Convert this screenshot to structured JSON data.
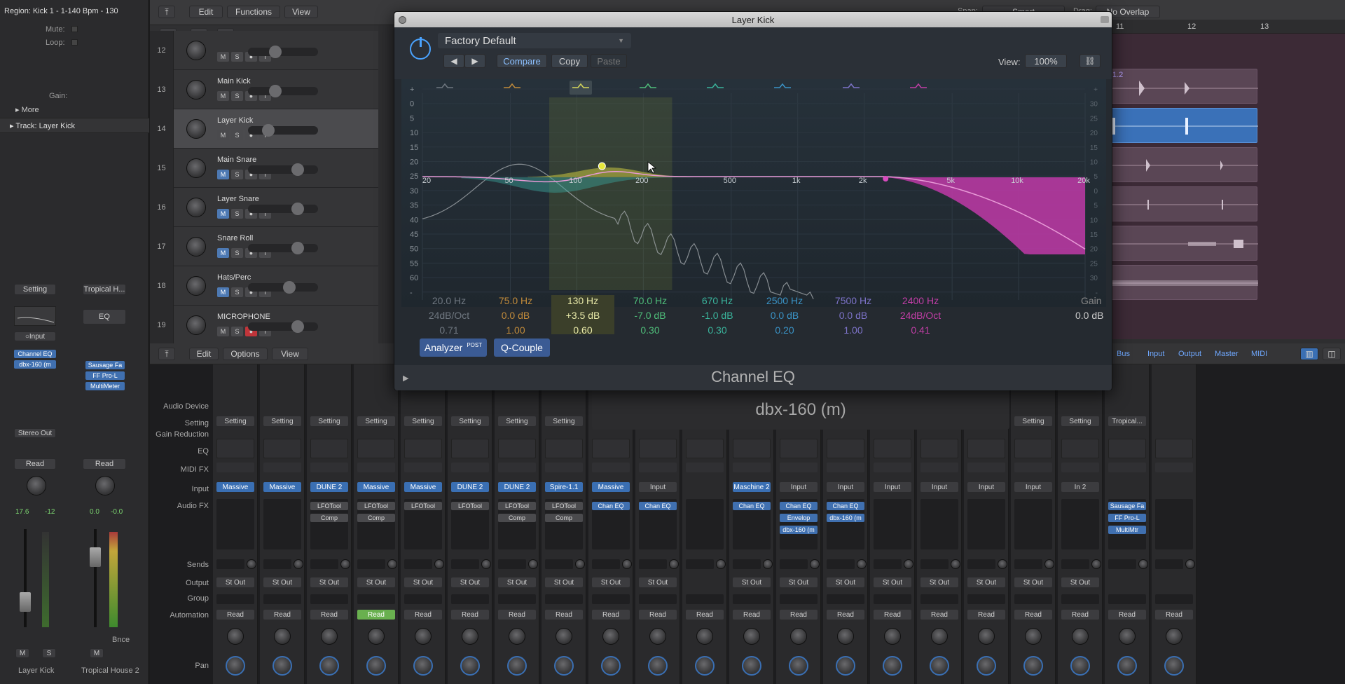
{
  "inspector": {
    "region_header": "Region: Kick 1 - 1-140 Bpm - 130",
    "mute_label": "Mute:",
    "loop_label": "Loop:",
    "gain_label": "Gain:",
    "more_label": "More",
    "track_label": "Track:  Layer Kick",
    "strip1": {
      "setting": "Setting",
      "input": "Input",
      "inserts": [
        "Channel EQ",
        "dbx-160 (m"
      ],
      "output": "Stereo Out",
      "automation": "Read",
      "vol": "17.6",
      "peak": "-12",
      "name": "Layer Kick",
      "m": "M",
      "s": "S"
    },
    "strip2": {
      "setting": "Tropical H...",
      "eq": "EQ",
      "inserts": [
        "Sausage Fa",
        "FF Pro-L",
        "MultiMeter"
      ],
      "automation": "Read",
      "vol": "0.0",
      "peak": "-0.0",
      "bnce": "Bnce",
      "name": "Tropical House 2",
      "m": "M"
    }
  },
  "arrange_toolbar": {
    "edit": "Edit",
    "functions": "Functions",
    "view": "View",
    "snap_label": "Snap:",
    "snap_value": "Smart",
    "drag_label": "Drag:",
    "drag_value": "No Overlap"
  },
  "track_header_btns": {
    "add": "+",
    "s": "S"
  },
  "tracks": [
    {
      "num": "12",
      "name": ""
    },
    {
      "num": "13",
      "name": "Main Kick"
    },
    {
      "num": "14",
      "name": "Layer Kick"
    },
    {
      "num": "15",
      "name": "Main Snare"
    },
    {
      "num": "16",
      "name": "Layer Snare"
    },
    {
      "num": "17",
      "name": "Snare Roll"
    },
    {
      "num": "18",
      "name": "Hats/Perc"
    },
    {
      "num": "19",
      "name": "MICROPHONE"
    }
  ],
  "ruler": [
    "11",
    "12",
    "13"
  ],
  "region_label": "1.2",
  "plugin": {
    "title": "Layer Kick",
    "preset": "Factory Default",
    "compare": "Compare",
    "copy": "Copy",
    "paste": "Paste",
    "view_label": "View:",
    "view_value": "100%",
    "db_scale": [
      "+",
      "0",
      "5",
      "10",
      "15",
      "20",
      "25",
      "30",
      "35",
      "40",
      "45",
      "50",
      "55",
      "60",
      "-"
    ],
    "right_scale": [
      "+",
      "30",
      "25",
      "20",
      "15",
      "10",
      "5",
      "0",
      "5",
      "10",
      "15",
      "20",
      "25",
      "30",
      "-"
    ],
    "freq_labels": [
      "20",
      "50",
      "100",
      "200",
      "500",
      "1k",
      "2k",
      "5k",
      "10k",
      "20k"
    ],
    "bands": [
      {
        "freq": "20.0 Hz",
        "gain": "24dB/Oct",
        "q": "0.71",
        "color": "#6f7780"
      },
      {
        "freq": "75.0 Hz",
        "gain": "0.0 dB",
        "q": "1.00",
        "color": "#c08a3a"
      },
      {
        "freq": "130 Hz",
        "gain": "+3.5 dB",
        "q": "0.60",
        "color": "#d5d65a"
      },
      {
        "freq": "70.0 Hz",
        "gain": "-7.0 dB",
        "q": "0.30",
        "color": "#4fbe7a"
      },
      {
        "freq": "670 Hz",
        "gain": "-1.0 dB",
        "q": "0.30",
        "color": "#3ab39b"
      },
      {
        "freq": "2500 Hz",
        "gain": "0.0 dB",
        "q": "0.20",
        "color": "#3a93c6"
      },
      {
        "freq": "7500 Hz",
        "gain": "0.0 dB",
        "q": "1.00",
        "color": "#7d73c9"
      },
      {
        "freq": "2400 Hz",
        "gain": "24dB/Oct",
        "q": "0.41",
        "color": "#c13ea6"
      }
    ],
    "gain_label": "Gain",
    "gain_value": "0.0 dB",
    "analyzer": "Analyzer",
    "analyzer_tag": "POST",
    "qcouple": "Q-Couple",
    "footer": "Channel EQ"
  },
  "dbx": {
    "name": "dbx-160 (m)"
  },
  "mixer_toolbar": {
    "edit": "Edit",
    "options": "Options",
    "view": "View",
    "tabs": [
      "Bus",
      "Input",
      "Output",
      "Master",
      "MIDI"
    ]
  },
  "mixer_labels": [
    "Audio Device",
    "Setting",
    "Gain Reduction",
    "EQ",
    "MIDI FX",
    "Input",
    "Audio FX",
    "Sends",
    "Output",
    "Group",
    "Automation",
    "Pan"
  ],
  "strips": [
    {
      "setting": "Setting",
      "input": "Massive",
      "fx": [],
      "output": "St Out",
      "auto": "Read"
    },
    {
      "setting": "Setting",
      "input": "Massive",
      "fx": [],
      "output": "St Out",
      "auto": "Read"
    },
    {
      "setting": "Setting",
      "input": "DUNE 2",
      "fx": [
        "LFOTool",
        "Comp"
      ],
      "output": "St Out",
      "auto": "Read"
    },
    {
      "setting": "Setting",
      "input": "Massive",
      "fx": [
        "LFOTool",
        "Comp"
      ],
      "output": "St Out",
      "auto": "Read"
    },
    {
      "setting": "Setting",
      "input": "Massive",
      "fx": [
        "LFOTool"
      ],
      "output": "St Out",
      "auto": "Read"
    },
    {
      "setting": "Setting",
      "input": "DUNE 2",
      "fx": [
        "LFOTool"
      ],
      "output": "St Out",
      "auto": "Read"
    },
    {
      "setting": "Setting",
      "input": "DUNE 2",
      "fx": [
        "LFOTool",
        "Comp"
      ],
      "output": "St Out",
      "auto": "Read"
    },
    {
      "setting": "Setting",
      "input": "Spire-1.1",
      "fx": [
        "LFOTool",
        "Comp"
      ],
      "output": "St Out",
      "auto": "Read"
    },
    {
      "setting": "",
      "input": "Massive",
      "fx": [
        "Chan EQ"
      ],
      "output": "St Out",
      "auto": "Read"
    },
    {
      "setting": "",
      "input": "Input",
      "fx": [
        "Chan EQ"
      ],
      "output": "St Out",
      "auto": "Read"
    },
    {
      "setting": "",
      "input": "",
      "fx": [],
      "output": "",
      "auto": "Read"
    },
    {
      "setting": "",
      "input": "Maschine 2",
      "fx": [
        "Chan EQ"
      ],
      "output": "St Out",
      "auto": "Read"
    },
    {
      "setting": "",
      "input": "Input",
      "fx": [
        "Chan EQ",
        "Envelop",
        "dbx-160 (m"
      ],
      "output": "St Out",
      "auto": "Read"
    },
    {
      "setting": "",
      "input": "Input",
      "fx": [
        "Chan EQ",
        "dbx-160 (m"
      ],
      "output": "St Out",
      "auto": "Read"
    },
    {
      "setting": "",
      "input": "Input",
      "fx": [],
      "output": "St Out",
      "auto": "Read"
    },
    {
      "setting": "",
      "input": "Input",
      "fx": [],
      "output": "St Out",
      "auto": "Read"
    },
    {
      "setting": "",
      "input": "Input",
      "fx": [],
      "output": "St Out",
      "auto": "Read"
    },
    {
      "setting": "Setting",
      "input": "Input",
      "fx": [],
      "output": "St Out",
      "auto": "Read"
    },
    {
      "setting": "Setting",
      "input": "In 2",
      "fx": [],
      "output": "St Out",
      "auto": "Read"
    },
    {
      "setting": "Tropical...",
      "input": "",
      "fx": [
        "Sausage Fa",
        "FF Pro-L",
        "MultiMtr"
      ],
      "output": "",
      "auto": "Read"
    },
    {
      "setting": "",
      "input": "",
      "fx": [],
      "output": "",
      "auto": "Read"
    }
  ]
}
